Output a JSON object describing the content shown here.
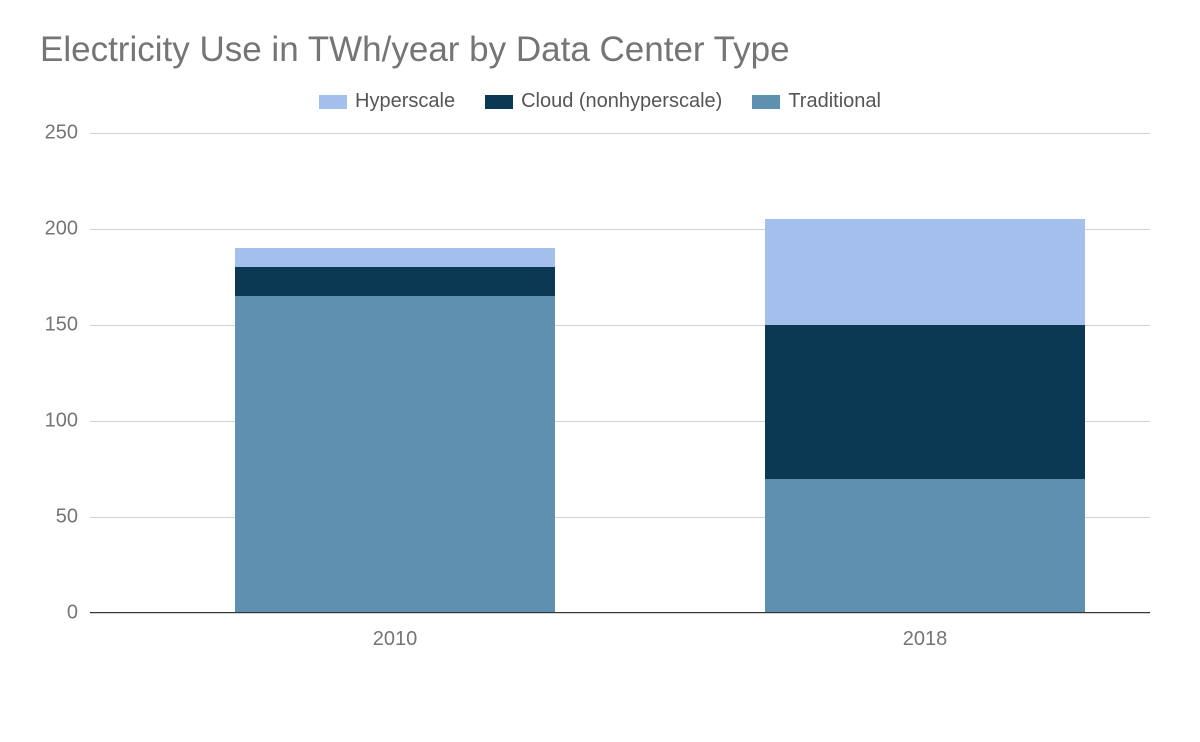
{
  "chart_data": {
    "type": "bar",
    "stacked": true,
    "title": "Electricity Use in TWh/year by Data Center Type",
    "categories": [
      "2010",
      "2018"
    ],
    "series": [
      {
        "name": "Traditional",
        "values": [
          165,
          70
        ],
        "color": "#5e91af"
      },
      {
        "name": "Cloud (nonhyperscale)",
        "values": [
          15,
          80
        ],
        "color": "#0b3954"
      },
      {
        "name": "Hyperscale",
        "values": [
          10,
          55
        ],
        "color": "#a2c0eb"
      }
    ],
    "ylim": [
      0,
      250
    ],
    "y_ticks": [
      0,
      50,
      100,
      150,
      200,
      250
    ],
    "xlabel": "",
    "ylabel": ""
  },
  "legend_order": [
    "Hyperscale",
    "Cloud (nonhyperscale)",
    "Traditional"
  ]
}
